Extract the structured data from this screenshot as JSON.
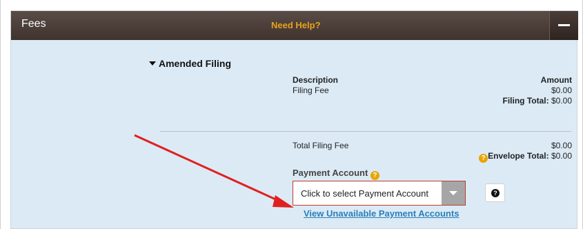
{
  "header": {
    "title": "Fees",
    "help_link": "Need Help?",
    "collapse_icon": "minus-icon"
  },
  "filing": {
    "section_title": "Amended Filing",
    "description_header": "Description",
    "amount_header": "Amount",
    "fee_label": "Filing Fee",
    "fee_amount": "$0.00",
    "filing_total_label": "Filing Total:",
    "filing_total_value": "$0.00"
  },
  "totals": {
    "total_filing_fee_label": "Total Filing Fee",
    "total_filing_fee_value": "$0.00",
    "envelope_total_label": "Envelope Total:",
    "envelope_total_value": "$0.00"
  },
  "payment": {
    "label": "Payment Account",
    "select_placeholder": "Click to select Payment Account",
    "unavailable_link": "View Unavailable Payment Accounts",
    "help_icon": "question-icon"
  },
  "colors": {
    "header_bg": "#4d403a",
    "panel_bg": "#dbeaf5",
    "help_link": "#e8a21c",
    "link": "#2a7fb8",
    "annotation_arrow": "#e02020"
  }
}
